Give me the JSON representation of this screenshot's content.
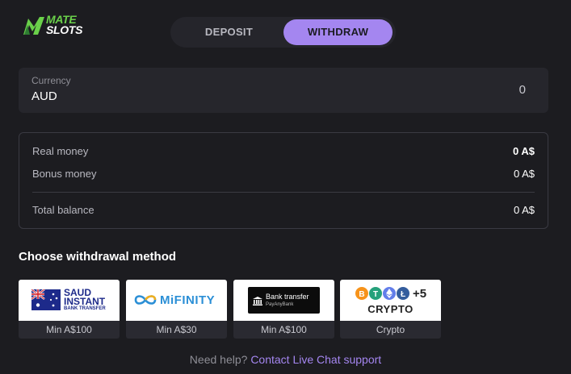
{
  "logo": {
    "line1": "MATE",
    "line2": "SLOTS"
  },
  "tabs": {
    "deposit": "DEPOSIT",
    "withdraw": "WITHDRAW"
  },
  "currency": {
    "label": "Currency",
    "value": "AUD",
    "amount": "0"
  },
  "balance": {
    "real_label": "Real money",
    "real_value": "0 A$",
    "bonus_label": "Bonus money",
    "bonus_value": "0 A$",
    "total_label": "Total balance",
    "total_value": "0 A$"
  },
  "section_title": "Choose withdrawal method",
  "methods": [
    {
      "logo_line1": "SAUD",
      "logo_line2": "INSTANT",
      "logo_line3": "BANK TRANSFER",
      "caption": "Min A$100"
    },
    {
      "logo_text": "MiFINITY",
      "caption": "Min A$30"
    },
    {
      "logo_line1": "Bank transfer",
      "logo_line2": "PayAnyBank",
      "caption": "Min A$100"
    },
    {
      "logo_more": "+5",
      "logo_text": "CRYPTO",
      "caption": "Crypto"
    }
  ],
  "help": {
    "text": "Need help?",
    "link": "Contact Live Chat support"
  },
  "colors": {
    "accent": "#a486f0",
    "brand_green": "#6ad04a",
    "background": "#1c1c20"
  }
}
